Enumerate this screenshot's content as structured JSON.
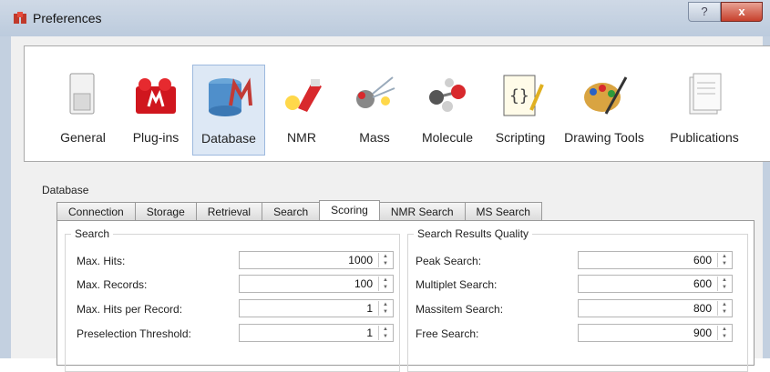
{
  "window": {
    "title": "Preferences",
    "help_label": "?",
    "close_label": "x"
  },
  "toolbar": {
    "items": [
      {
        "label": "General",
        "icon": "general-icon"
      },
      {
        "label": "Plug-ins",
        "icon": "plugins-icon"
      },
      {
        "label": "Database",
        "icon": "database-icon",
        "selected": true
      },
      {
        "label": "NMR",
        "icon": "nmr-icon"
      },
      {
        "label": "Mass",
        "icon": "mass-icon"
      },
      {
        "label": "Molecule",
        "icon": "molecule-icon"
      },
      {
        "label": "Scripting",
        "icon": "scripting-icon"
      },
      {
        "label": "Drawing Tools",
        "icon": "drawing-tools-icon"
      },
      {
        "label": "Publications",
        "icon": "publications-icon"
      }
    ]
  },
  "database": {
    "group_label": "Database",
    "tabs": [
      "Connection",
      "Storage",
      "Retrieval",
      "Search",
      "Scoring",
      "NMR Search",
      "MS Search"
    ],
    "active_tab": "Scoring",
    "search": {
      "title": "Search",
      "rows": [
        {
          "label": "Max. Hits:",
          "value": "1000"
        },
        {
          "label": "Max. Records:",
          "value": "100"
        },
        {
          "label": "Max. Hits per Record:",
          "value": "1"
        },
        {
          "label": "Preselection Threshold:",
          "value": "1"
        }
      ]
    },
    "quality": {
      "title": "Search Results Quality",
      "rows": [
        {
          "label": "Peak Search:",
          "value": "600"
        },
        {
          "label": "Multiplet Search:",
          "value": "600"
        },
        {
          "label": "Massitem Search:",
          "value": "800"
        },
        {
          "label": "Free Search:",
          "value": "900"
        }
      ]
    }
  },
  "colors": {
    "title_bar": "#c6d3e3",
    "close_button": "#c7402c",
    "selected_item": "#dde8f5"
  }
}
